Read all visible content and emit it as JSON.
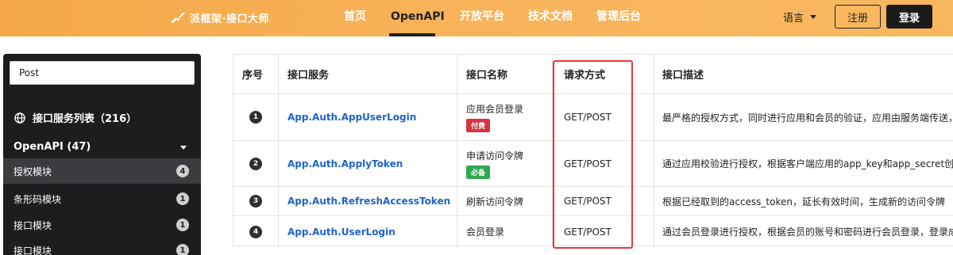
{
  "header": {
    "logo_text": "派框架·接口大师",
    "nav": [
      "首页",
      "OpenAPI",
      "开放平台",
      "技术文档",
      "管理后台"
    ],
    "active_nav": "OpenAPI",
    "language_label": "语言",
    "register_label": "注册",
    "login_label": "登录"
  },
  "sidebar": {
    "search_value": "Post",
    "api_list_title": "接口服务列表（216）",
    "group_title": "OpenAPI (47)",
    "items": [
      {
        "label": "授权模块",
        "count": "4",
        "active": true
      },
      {
        "label": "条形码模块",
        "count": "1",
        "active": false
      },
      {
        "label": "接口模块",
        "count": "1",
        "active": false
      },
      {
        "label": "接口模块",
        "count": "1",
        "active": false
      }
    ]
  },
  "table": {
    "headers": [
      "序号",
      "接口服务",
      "接口名称",
      "请求方式",
      "接口描述"
    ],
    "rows": [
      {
        "num": "1",
        "service": "App.Auth.AppUserLogin",
        "name": "应用会员登录",
        "tag": "付费",
        "tag_color": "#d9333f",
        "method": "GET/POST",
        "desc": "最严格的授权方式，同时进行应用和会员的验证，应用由服务端传送，会"
      },
      {
        "num": "2",
        "service": "App.Auth.ApplyToken",
        "name": "申请访问令牌",
        "tag": "必备",
        "tag_color": "#2fa84f",
        "method": "GET/POST",
        "desc": "通过应用校验进行授权，根据客户端应用的app_key和app_secret创建新"
      },
      {
        "num": "3",
        "service": "App.Auth.RefreshAccessToken",
        "name": "刷新访问令牌",
        "tag": "",
        "tag_color": "",
        "method": "GET/POST",
        "desc": "根据已经取到的access_token，延长有效时间，生成新的访问令牌"
      },
      {
        "num": "4",
        "service": "App.Auth.UserLogin",
        "name": "会员登录",
        "tag": "",
        "tag_color": "",
        "method": "GET/POST",
        "desc": "通过会员登录进行授权，根据会员的账号和密码进行会员登录，登录成功"
      }
    ]
  },
  "colors": {
    "topbar": "#f8b35a",
    "sidebar_bg": "#1b1d1f",
    "link": "#2164c8",
    "highlight_border": "#e03b3b"
  }
}
